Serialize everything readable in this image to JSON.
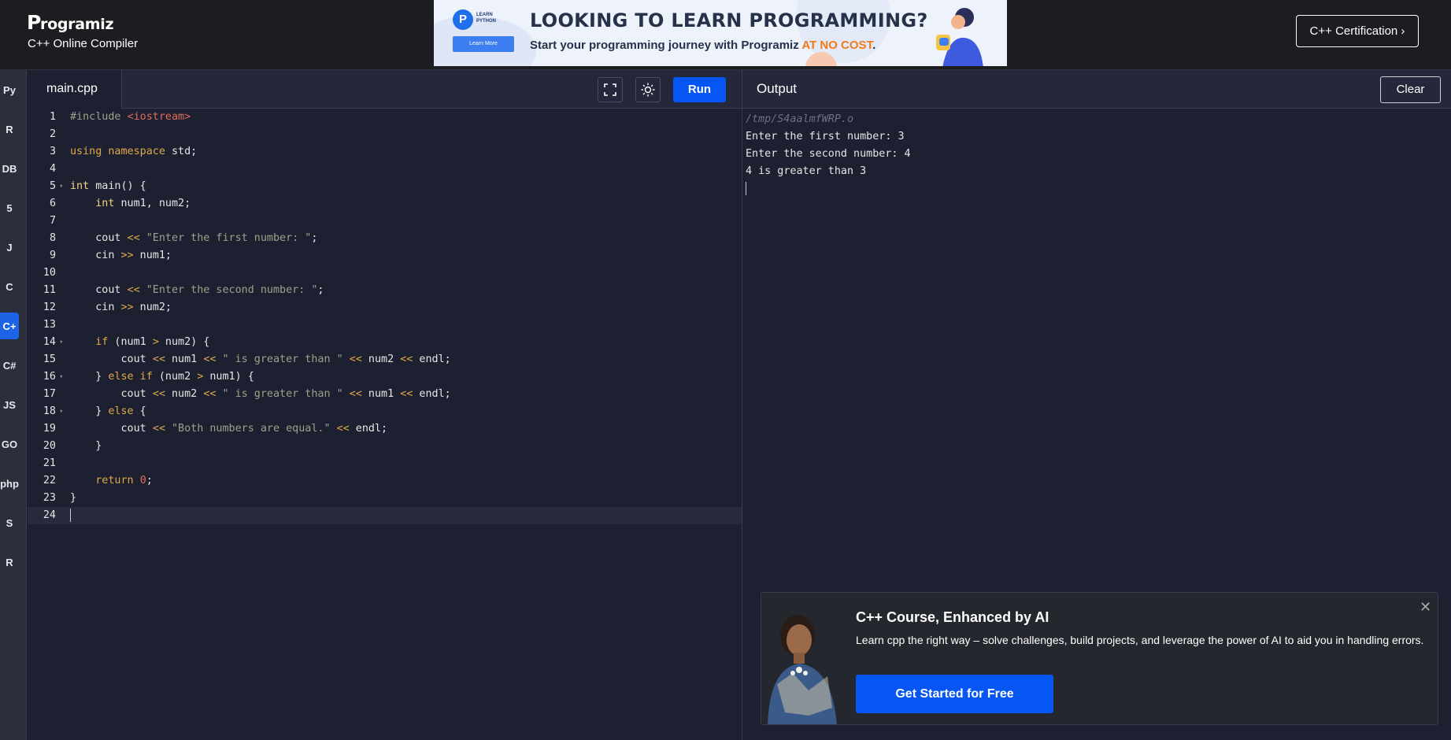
{
  "header": {
    "logo": "Programiz",
    "subtitle": "C++ Online Compiler",
    "certification_button": "C++ Certification ›"
  },
  "banner": {
    "badge_text": "LEARN PYTHON",
    "learn_more": "Learn More",
    "title": "LOOKING TO LEARN PROGRAMMING?",
    "subtitle": "Start your programming journey with Programiz",
    "highlight": "AT NO COST",
    "period": "."
  },
  "sidebar": {
    "items": [
      {
        "name": "python-icon",
        "glyph": "Py"
      },
      {
        "name": "r-icon",
        "glyph": "R"
      },
      {
        "name": "sql-icon",
        "glyph": "DB"
      },
      {
        "name": "html-icon",
        "glyph": "5"
      },
      {
        "name": "java-icon",
        "glyph": "J"
      },
      {
        "name": "c-icon",
        "glyph": "C"
      },
      {
        "name": "cpp-icon",
        "glyph": "C+"
      },
      {
        "name": "csharp-icon",
        "glyph": "C#"
      },
      {
        "name": "js-icon",
        "glyph": "JS"
      },
      {
        "name": "go-icon",
        "glyph": "GO"
      },
      {
        "name": "php-icon",
        "glyph": "php"
      },
      {
        "name": "swift-icon",
        "glyph": "S"
      },
      {
        "name": "rust-icon",
        "glyph": "R"
      }
    ],
    "active_index": 6
  },
  "editor": {
    "tab_label": "main.cpp",
    "run_label": "Run",
    "lines": [
      "1",
      "2",
      "3",
      "4",
      "5",
      "6",
      "7",
      "8",
      "9",
      "10",
      "11",
      "12",
      "13",
      "14",
      "15",
      "16",
      "17",
      "18",
      "19",
      "20",
      "21",
      "22",
      "23",
      "24"
    ]
  },
  "output": {
    "title": "Output",
    "clear_label": "Clear",
    "path": "/tmp/S4aalmfWRP.o",
    "lines": [
      "Enter the first number: 3",
      "Enter the second number: 4",
      "4 is greater than 3"
    ]
  },
  "promo": {
    "title": "C++ Course, Enhanced by AI",
    "description": "Learn cpp the right way – solve challenges, build projects, and leverage the power of AI to aid you in handling errors.",
    "button": "Get Started for Free",
    "close": "✕"
  },
  "colors": {
    "accent": "#0556f3",
    "background": "#1d2030",
    "topbar": "#1b1d20",
    "highlight": "#f07b1a"
  }
}
